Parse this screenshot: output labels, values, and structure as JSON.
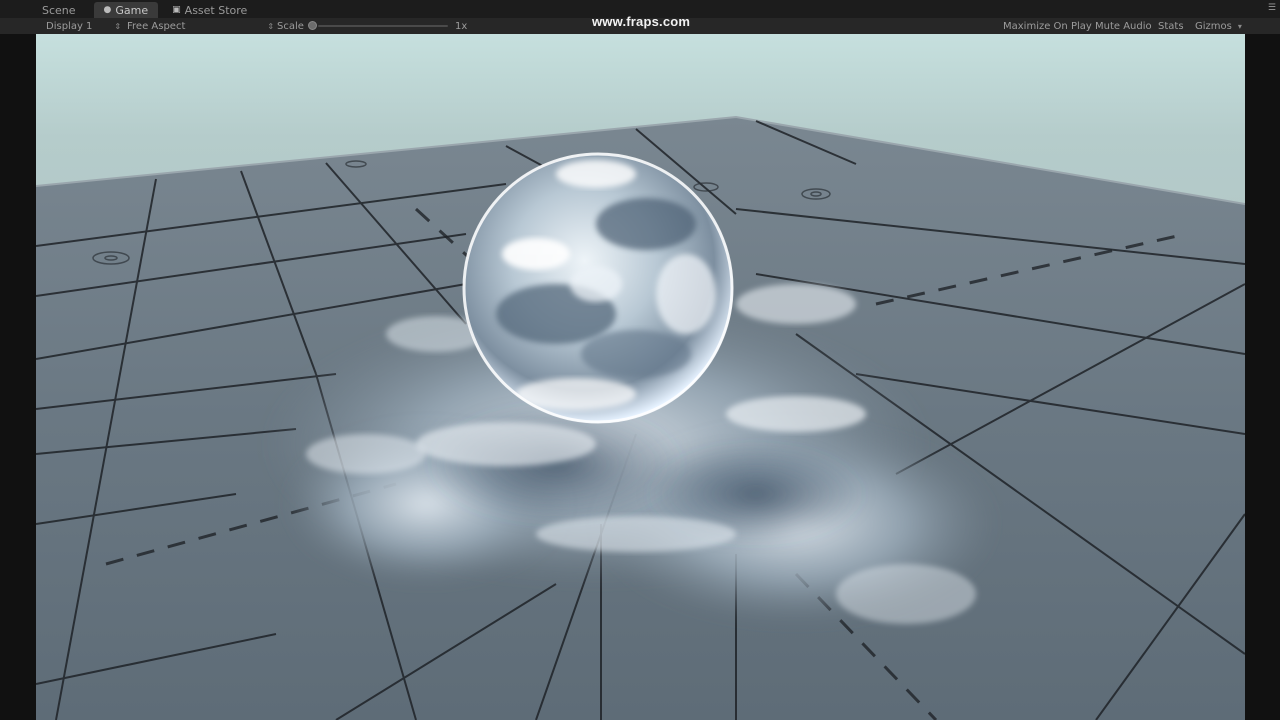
{
  "tabs": [
    {
      "label": "Scene"
    },
    {
      "label": "Game"
    },
    {
      "label": "Asset Store"
    }
  ],
  "toolbar": {
    "display": "Display 1",
    "aspect": "Free Aspect",
    "scale_label": "Scale",
    "scale_value": "1x",
    "scale_fraction": 0.0,
    "buttons": [
      "Maximize On Play",
      "Mute Audio",
      "Stats",
      "Gizmos"
    ]
  },
  "overlay": {
    "watermark": "www.fraps.com"
  },
  "icons": {
    "game_tab": "gamepad-icon",
    "asset_store_tab": "shopping-bag-icon",
    "panel_menu": "panel-menu-icon"
  },
  "colors": {
    "sky_top": "#b6d2d0",
    "sky_bottom": "#a9b6b7",
    "floor": "#6e7c87",
    "ice": "#c8d8e6",
    "grid_line": "#1f2328"
  }
}
